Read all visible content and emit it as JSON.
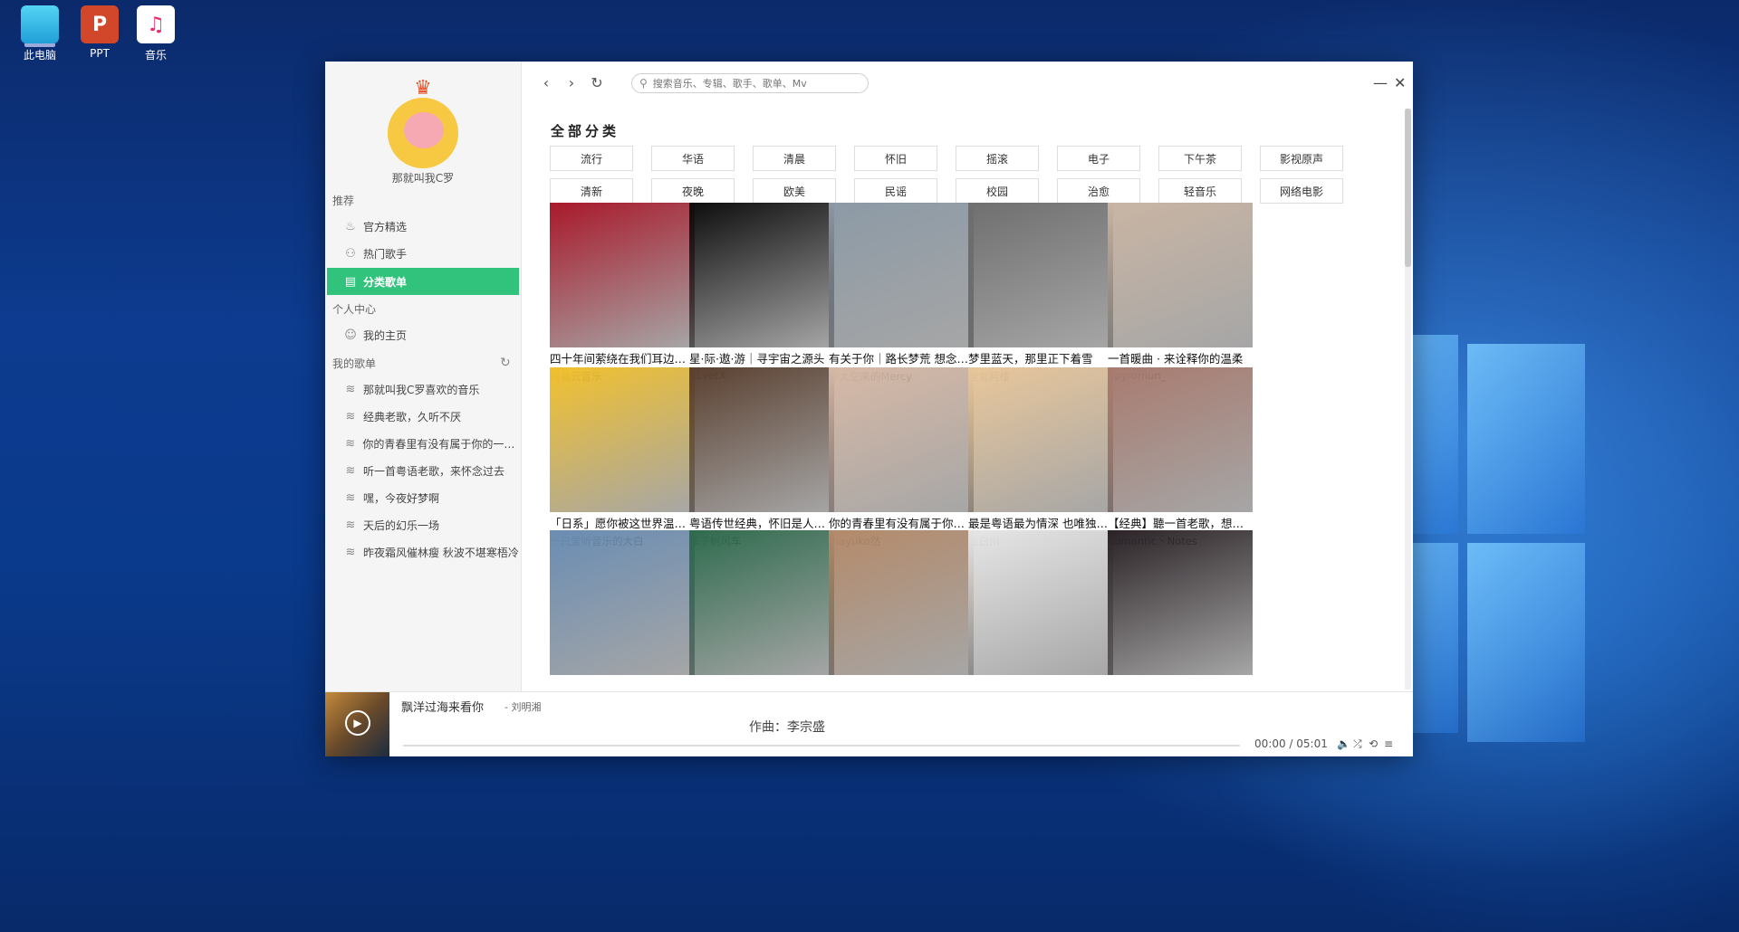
{
  "desktop": {
    "icons": [
      {
        "label": "此电脑",
        "icon": "computer-icon"
      },
      {
        "label": "PPT",
        "icon": "powerpoint-icon"
      },
      {
        "label": "音乐",
        "icon": "music-app-icon"
      }
    ]
  },
  "sidebar": {
    "username": "那就叫我C罗",
    "recommend_title": "推荐",
    "recommend_items": [
      {
        "label": "官方精选",
        "icon": "flame-icon"
      },
      {
        "label": "热门歌手",
        "icon": "user-icon"
      },
      {
        "label": "分类歌单",
        "icon": "list-icon"
      }
    ],
    "personal_title": "个人中心",
    "personal_items": [
      {
        "label": "我的主页",
        "icon": "smile-icon"
      }
    ],
    "playlists_title": "我的歌单",
    "playlists": [
      "那就叫我C罗喜欢的音乐",
      "经典老歌，久听不厌",
      "你的青春里有没有属于你的一首歌",
      "听一首粤语老歌，来怀念过去",
      "嘿，今夜好梦啊",
      "天后的幻乐一场",
      "昨夜霜风催林瘦 秋波不堪寒梧冷"
    ]
  },
  "topbar": {
    "search_placeholder": "搜索音乐、专辑、歌手、歌单、Mv"
  },
  "categories": {
    "title": "全部分类",
    "row1": [
      "流行",
      "华语",
      "清晨",
      "怀旧",
      "摇滚",
      "电子",
      "下午茶",
      "影视原声"
    ],
    "row2": [
      "清新",
      "夜晚",
      "欧美",
      "民谣",
      "校园",
      "治愈",
      "轻音乐",
      "网络电影"
    ]
  },
  "playlists_grid": [
    {
      "title": "四十年间萦绕在我们耳边的旋律",
      "author": "网易云音乐",
      "color": "#a8192b"
    },
    {
      "title": "星·际·遨·游｜寻宇宙之源头",
      "author": "ALvetX",
      "color": "#0d0d0d"
    },
    {
      "title": "有关于你｜路长梦荒 想念成疾",
      "author": "外太空来的Mercy",
      "color": "#8c9aa6"
    },
    {
      "title": "梦里蓝天，那里正下着雪",
      "author": "重复阿楼",
      "color": "#6f6f6f"
    },
    {
      "title": "一首暖曲 · 来诠释你的温柔",
      "author": "Spyromun_",
      "color": "#c9b5a4"
    },
    {
      "title": "「日系」愿你被这世界温柔以待",
      "author": "一只爱听音乐的大白",
      "color": "#f2c12e"
    },
    {
      "title": "粤语传世经典，怀旧是人的本能",
      "author": "橘子树风车",
      "color": "#5a4030"
    },
    {
      "title": "你的青春里有没有属于你的一首歌",
      "author": "mayuko然",
      "color": "#d7b9a6"
    },
    {
      "title": "最是粤语最为情深 也唯独粤语",
      "author": "鹿白川",
      "color": "#e9c79b"
    },
    {
      "title": "【经典】聽一首老歌，想一個人",
      "author": "Romantic丶Notes",
      "color": "#a87b6f"
    },
    {
      "title": "",
      "author": "",
      "color": "#6a8db3"
    },
    {
      "title": "",
      "author": "",
      "color": "#2f6b4e"
    },
    {
      "title": "",
      "author": "",
      "color": "#b48a6a"
    },
    {
      "title": "",
      "author": "",
      "color": "#e6e6e6"
    },
    {
      "title": "",
      "author": "",
      "color": "#2a2226"
    }
  ],
  "player": {
    "song": "飘洋过海来看你",
    "artist": "- 刘明湘",
    "lyric": "作曲：李宗盛",
    "time": "00:00 / 05:01",
    "progress": 0
  }
}
